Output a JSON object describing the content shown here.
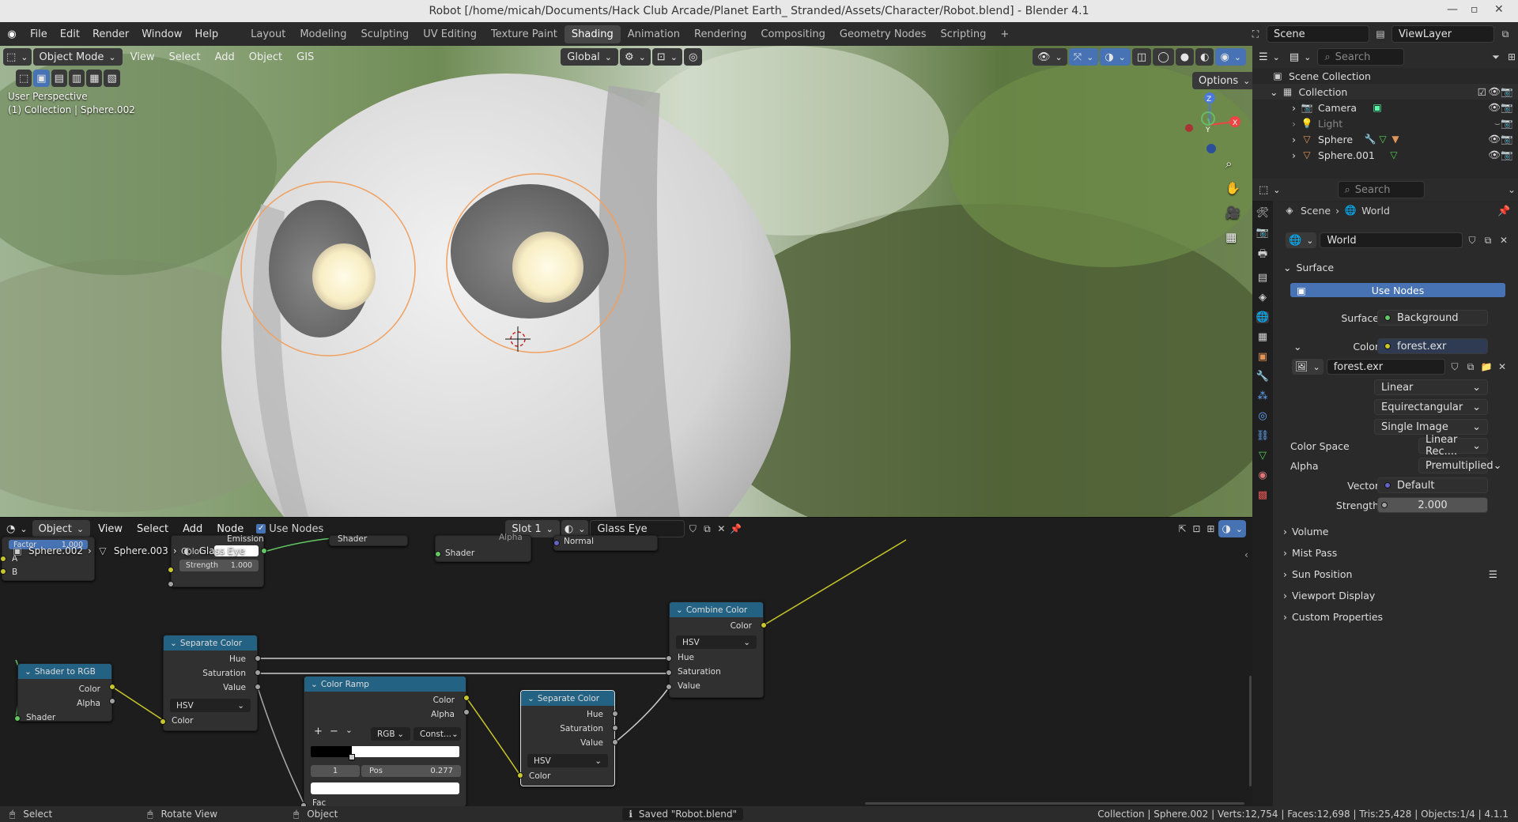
{
  "window": {
    "title": "Robot [/home/micah/Documents/Hack Club Arcade/Planet Earth_ Stranded/Assets/Character/Robot.blend] - Blender 4.1"
  },
  "menus": [
    "File",
    "Edit",
    "Render",
    "Window",
    "Help"
  ],
  "workspaces": [
    "Layout",
    "Modeling",
    "Sculpting",
    "UV Editing",
    "Texture Paint",
    "Shading",
    "Animation",
    "Rendering",
    "Compositing",
    "Geometry Nodes",
    "Scripting"
  ],
  "active_workspace": "Shading",
  "scene": "Scene",
  "view_layer": "ViewLayer",
  "viewport": {
    "mode": "Object Mode",
    "menus": [
      "View",
      "Select",
      "Add",
      "Object",
      "GIS"
    ],
    "transform": "Global",
    "options": "Options",
    "persp": "User Perspective",
    "collection_info": "(1) Collection | Sphere.002",
    "axes": {
      "x": "X",
      "y": "Y",
      "z": "Z"
    }
  },
  "node_editor": {
    "type": "Object",
    "menus": [
      "View",
      "Select",
      "Add",
      "Node"
    ],
    "use_nodes": "Use Nodes",
    "slot": "Slot 1",
    "material": "Glass Eye",
    "breadcrumb": [
      "Sphere.002",
      "Sphere.003",
      "Glass Eye"
    ],
    "nodes": {
      "top_partial": {
        "factor_label": "Factor",
        "factor_val": "1.000",
        "a": "A",
        "b": "B",
        "emission": "Emission",
        "color": "Color",
        "strength": "Strength",
        "strength_val": "1.000",
        "shader1": "Shader",
        "shader2": "Shader",
        "alpha": "Alpha",
        "normal": "Normal"
      },
      "shader_to_rgb": {
        "title": "Shader to RGB",
        "color": "Color",
        "alpha": "Alpha",
        "shader": "Shader"
      },
      "sep1": {
        "title": "Separate Color",
        "hue": "Hue",
        "sat": "Saturation",
        "val": "Value",
        "mode": "HSV",
        "color": "Color"
      },
      "ramp": {
        "title": "Color Ramp",
        "color": "Color",
        "alpha": "Alpha",
        "plus": "+",
        "minus": "−",
        "mode": "RGB",
        "interp": "Const...",
        "index": "1",
        "pos_label": "Pos",
        "pos_val": "0.277",
        "fac": "Fac"
      },
      "sep2": {
        "title": "Separate Color",
        "hue": "Hue",
        "sat": "Saturation",
        "val": "Value",
        "mode": "HSV",
        "color": "Color"
      },
      "combine": {
        "title": "Combine Color",
        "color": "Color",
        "mode": "HSV",
        "hue": "Hue",
        "sat": "Saturation",
        "val": "Value"
      }
    }
  },
  "outliner": {
    "search": "Search",
    "root": "Scene Collection",
    "items": [
      {
        "name": "Collection",
        "level": 1
      },
      {
        "name": "Camera",
        "level": 2
      },
      {
        "name": "Light",
        "level": 2
      },
      {
        "name": "Sphere",
        "level": 2
      },
      {
        "name": "Sphere.001",
        "level": 2
      }
    ]
  },
  "properties": {
    "search": "Search",
    "breadcrumb": [
      "Scene",
      "World"
    ],
    "world_name": "World",
    "surface_header": "Surface",
    "use_nodes": "Use Nodes",
    "surface_label": "Surface",
    "surface_value": "Background",
    "color_label": "Color",
    "color_value": "forest.exr",
    "image": "forest.exr",
    "interp": "Linear",
    "projection": "Equirectangular",
    "source": "Single Image",
    "colorspace_label": "Color Space",
    "colorspace": "Linear Rec....",
    "alpha_label": "Alpha",
    "alpha": "Premultiplied",
    "vector_label": "Vector",
    "vector": "Default",
    "strength_label": "Strength",
    "strength": "2.000",
    "sections": [
      "Volume",
      "Mist Pass",
      "Sun Position",
      "Viewport Display",
      "Custom Properties"
    ]
  },
  "status": {
    "select": "Select",
    "rotate": "Rotate View",
    "object": "Object",
    "saved": "Saved \"Robot.blend\"",
    "stats": "Collection | Sphere.002 | Verts:12,754 | Faces:12,698 | Tris:25,428 | Objects:1/4 | 4.1.1"
  }
}
